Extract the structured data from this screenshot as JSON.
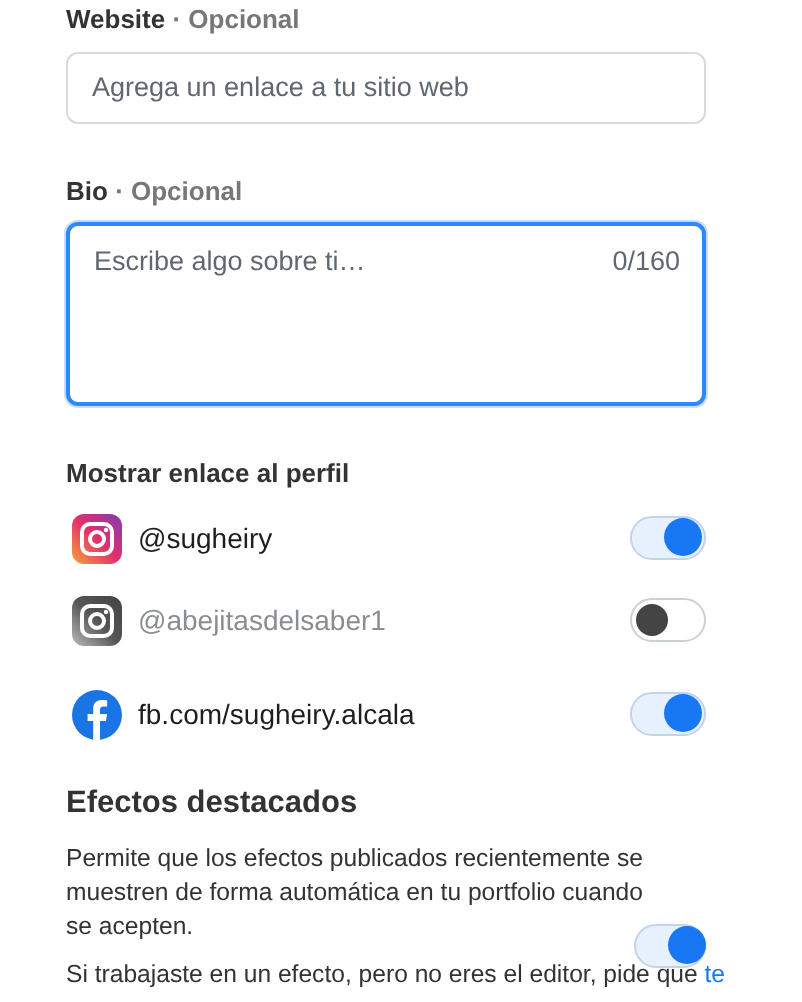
{
  "website": {
    "label": "Website",
    "optional": "· Opcional",
    "placeholder": "Agrega un enlace a tu sitio web"
  },
  "bio": {
    "label": "Bio",
    "optional": "· Opcional",
    "placeholder": "Escribe algo sobre ti…",
    "counter": "0/160",
    "focused": true
  },
  "links": {
    "title": "Mostrar enlace al perfil",
    "items": [
      {
        "kind": "instagram",
        "handle": "@sugheiry",
        "on": true
      },
      {
        "kind": "instagram",
        "handle": "@abejitasdelsaber1",
        "on": false
      },
      {
        "kind": "facebook",
        "handle": "fb.com/sugheiry.alcala",
        "on": true
      }
    ]
  },
  "featured": {
    "title": "Efectos destacados",
    "description": "Permite que los efectos publicados recientemente se muestren de forma automática en tu portfolio cuando se acepten.",
    "on": true,
    "note": "Si trabajaste en un efecto, pero no eres el editor, pide que",
    "note_link": "te"
  }
}
